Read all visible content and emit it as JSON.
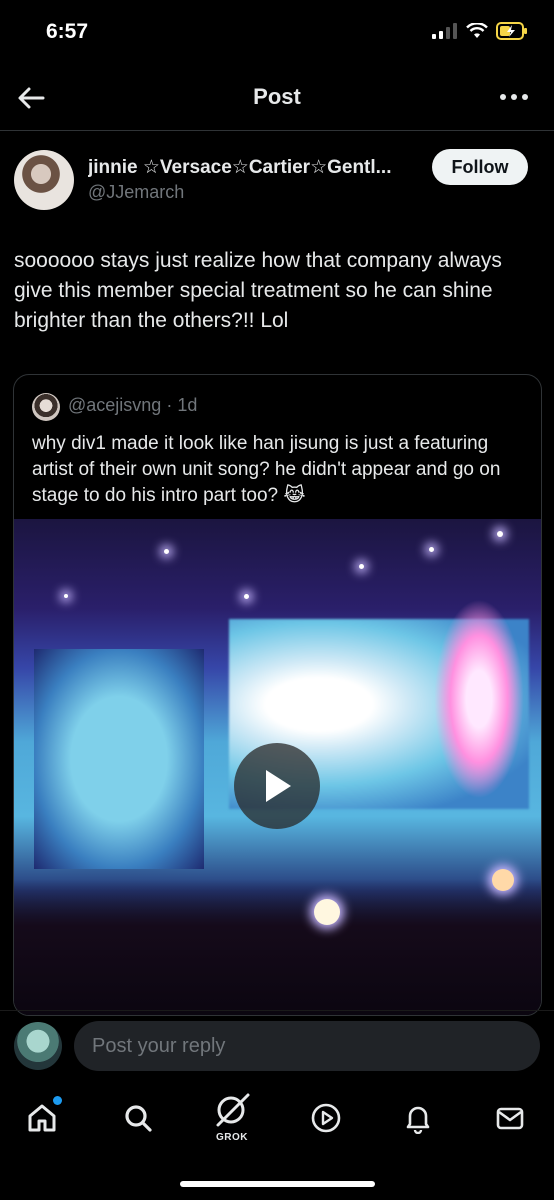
{
  "status_bar": {
    "time": "6:57"
  },
  "header": {
    "title": "Post"
  },
  "post": {
    "author_name": "jinnie ☆Versace☆Cartier☆Gentl...",
    "author_handle": "@JJemarch",
    "follow_label": "Follow",
    "text": "soooooo stays just realize how that company always give this member special treatment so he can shine brighter than the others?!! Lol"
  },
  "quote": {
    "handle": "@acejisvng",
    "separator": " · ",
    "time": "1d",
    "text": "why div1 made it look like han jisung is just a featuring artist of their own unit song? he didn't appear and go on stage to do his intro part too? 😹"
  },
  "reply": {
    "placeholder": "Post your reply"
  },
  "nav": {
    "grok_label": "GROK"
  },
  "colors": {
    "accent": "#1d9bf0",
    "background": "#000000",
    "muted": "#71767b"
  }
}
